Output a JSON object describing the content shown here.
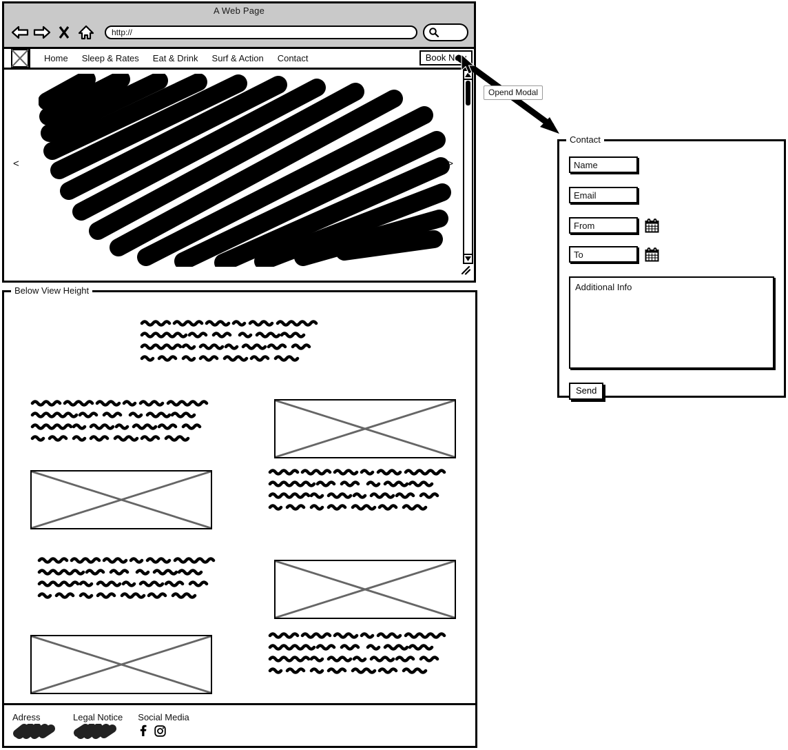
{
  "browser": {
    "title": "A Web Page",
    "url_value": "http://",
    "back_icon": "back-arrow-icon",
    "forward_icon": "forward-arrow-icon",
    "stop_icon": "close-x-icon",
    "home_icon": "home-icon",
    "search_icon": "search-icon"
  },
  "site_nav": {
    "logo": "logo-image-placeholder",
    "items": [
      {
        "label": "Home"
      },
      {
        "label": "Sleep & Rates"
      },
      {
        "label": "Eat & Drink"
      },
      {
        "label": "Surf & Action"
      },
      {
        "label": "Contact"
      }
    ],
    "cta_label": "Book Now"
  },
  "hero": {
    "prev_label": "<",
    "next_label": ">",
    "scrollbar": {
      "up_label": "▲",
      "down_label": "▼"
    }
  },
  "annotation": {
    "tooltip_label": "Opend Modal"
  },
  "modal": {
    "legend": "Contact",
    "fields": [
      {
        "name": "name",
        "value": "Name",
        "has_calendar": false
      },
      {
        "name": "email",
        "value": "Email",
        "has_calendar": false
      },
      {
        "name": "from",
        "value": "From",
        "has_calendar": true
      },
      {
        "name": "to",
        "value": "To",
        "has_calendar": true
      }
    ],
    "textarea_value": "Additional Info",
    "send_label": "Send",
    "calendar_icon": "calendar-icon"
  },
  "below_panel": {
    "legend": "Below View Height",
    "blocks": [
      {
        "type": "text",
        "id": "intro-text"
      },
      {
        "type": "text",
        "id": "block1-text"
      },
      {
        "type": "image",
        "id": "block1-image"
      },
      {
        "type": "image",
        "id": "block2-image"
      },
      {
        "type": "text",
        "id": "block2-text"
      },
      {
        "type": "text",
        "id": "block3-text"
      },
      {
        "type": "image",
        "id": "block3-image"
      },
      {
        "type": "image",
        "id": "block4-image"
      },
      {
        "type": "text",
        "id": "block4-text"
      }
    ]
  },
  "footer": {
    "columns": [
      {
        "title": "Adress",
        "content_type": "scribble"
      },
      {
        "title": "Legal Notice",
        "content_type": "scribble"
      },
      {
        "title": "Social Media",
        "content_type": "icons"
      }
    ],
    "social": [
      {
        "name": "facebook-icon",
        "glyph": "f"
      },
      {
        "name": "instagram-icon",
        "glyph": "▣"
      }
    ]
  }
}
